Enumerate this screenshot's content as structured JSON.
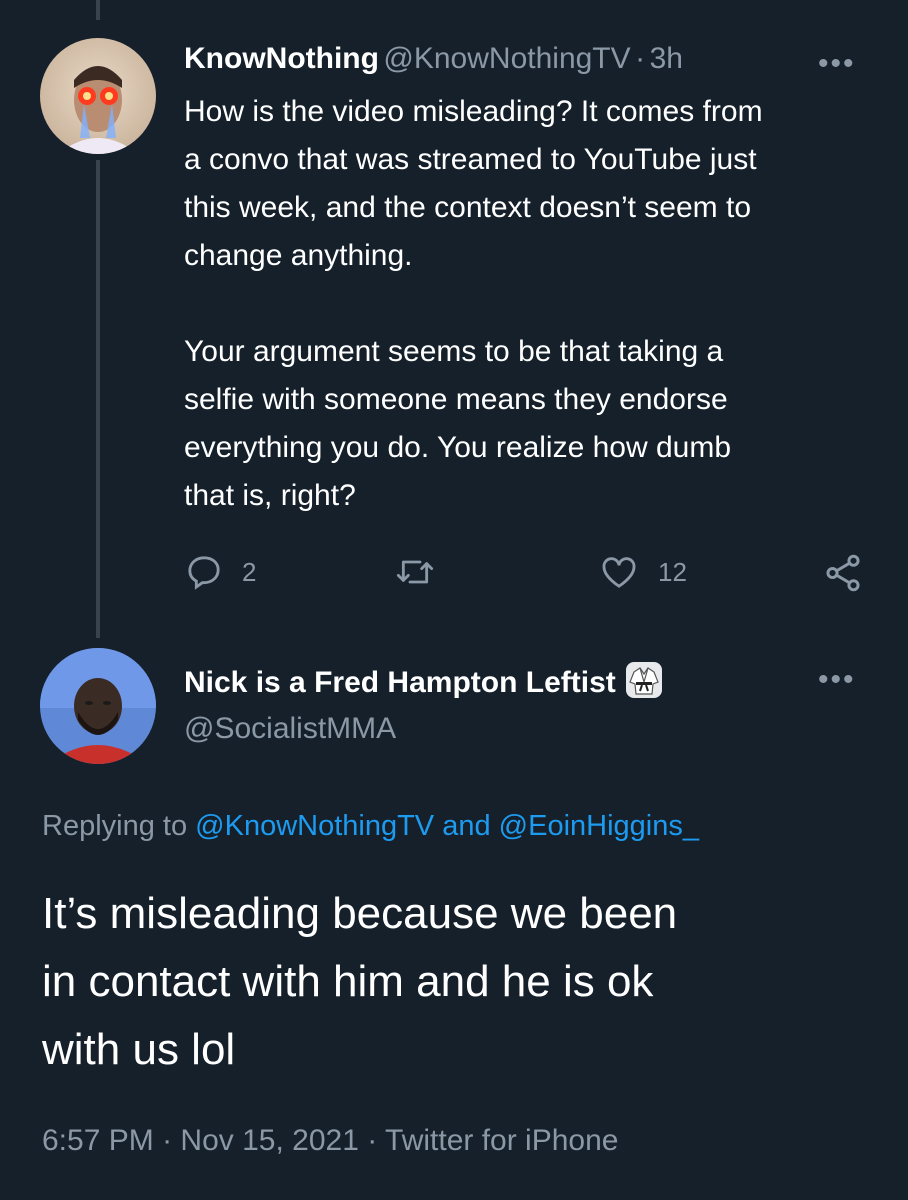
{
  "parent_tweet": {
    "display_name": "KnowNothing",
    "handle": "@KnowNothingTV",
    "separator": "·",
    "time": "3h",
    "more_glyph": "•••",
    "text": "How is the video misleading? It comes from\na convo that was streamed to YouTube just\nthis week, and the context doesn’t seem to\nchange anything.\n\nYour argument seems to be that taking a\nselfie with someone means they endorse\neverything you do. You realize how dumb\nthat is, right?",
    "actions": {
      "reply_icon": "reply-icon",
      "reply_count": "2",
      "retweet_icon": "retweet-icon",
      "like_icon": "heart-icon",
      "like_count": "12",
      "share_icon": "share-icon"
    }
  },
  "main_tweet": {
    "display_name": "Nick is a Fred Hampton Leftist",
    "badge_icon": "martial-arts-uniform-icon",
    "handle": "@SocialistMMA",
    "more_glyph": "•••",
    "replying_prefix": "Replying to",
    "replying_to_1": "@KnowNothingTV",
    "replying_and": "and",
    "replying_to_2": "@EoinHiggins_",
    "text": "It’s misleading because we been\nin contact with him and he is ok\nwith us lol",
    "time": "6:57 PM",
    "separator1": "·",
    "date": "Nov 15, 2021",
    "separator2": "·",
    "source": "Twitter for iPhone"
  },
  "colors": {
    "background": "#15202b",
    "text_primary": "#ffffff",
    "text_secondary": "#8b98a5",
    "link": "#1d9bf0",
    "thread_line": "#38444d"
  }
}
